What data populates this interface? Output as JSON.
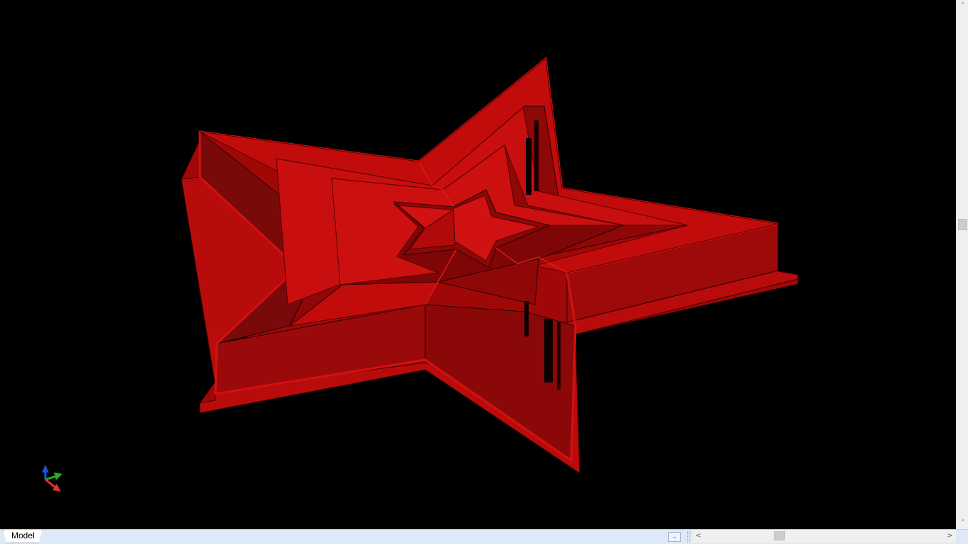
{
  "model_tabs": {
    "active_label": "Model"
  },
  "icons": {
    "tab_dropdown": "chevron-down-icon",
    "scroll_up": "chevron-up-icon",
    "scroll_down": "chevron-down-icon",
    "scroll_left": "chevron-left-icon",
    "scroll_right": "chevron-right-icon",
    "triad": "axis-triad-icon"
  },
  "glyphs": {
    "up": "˄",
    "down": "˅",
    "left": "<",
    "right": ">",
    "dropdown": "⌄"
  },
  "colors": {
    "background": "#000000",
    "model_primary": "#c00000",
    "model_face_light": "#d41010",
    "model_face_dark": "#7a0a0a",
    "axis_x": "#e03030",
    "axis_y": "#20b020",
    "axis_z": "#2050e0"
  }
}
